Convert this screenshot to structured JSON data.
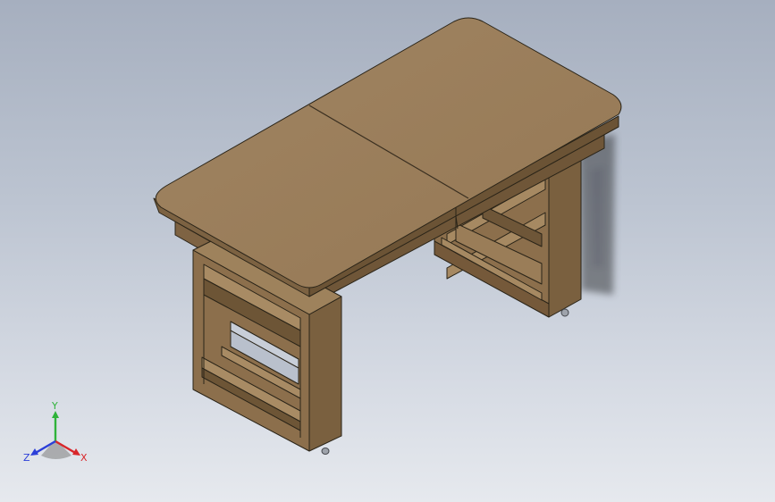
{
  "view": {
    "background_top": "#a6afbf",
    "background_bottom": "#e6e9ee"
  },
  "model": {
    "name": "",
    "wood_top_color": "#9a7c58",
    "wood_side_color": "#836846",
    "wood_dark_color": "#6e5638",
    "edge_color": "#2a2418"
  },
  "triad": {
    "x_label": "X",
    "y_label": "Y",
    "z_label": "Z",
    "x_color": "#d8262a",
    "y_color": "#2fb33a",
    "z_color": "#2b3fd8"
  }
}
